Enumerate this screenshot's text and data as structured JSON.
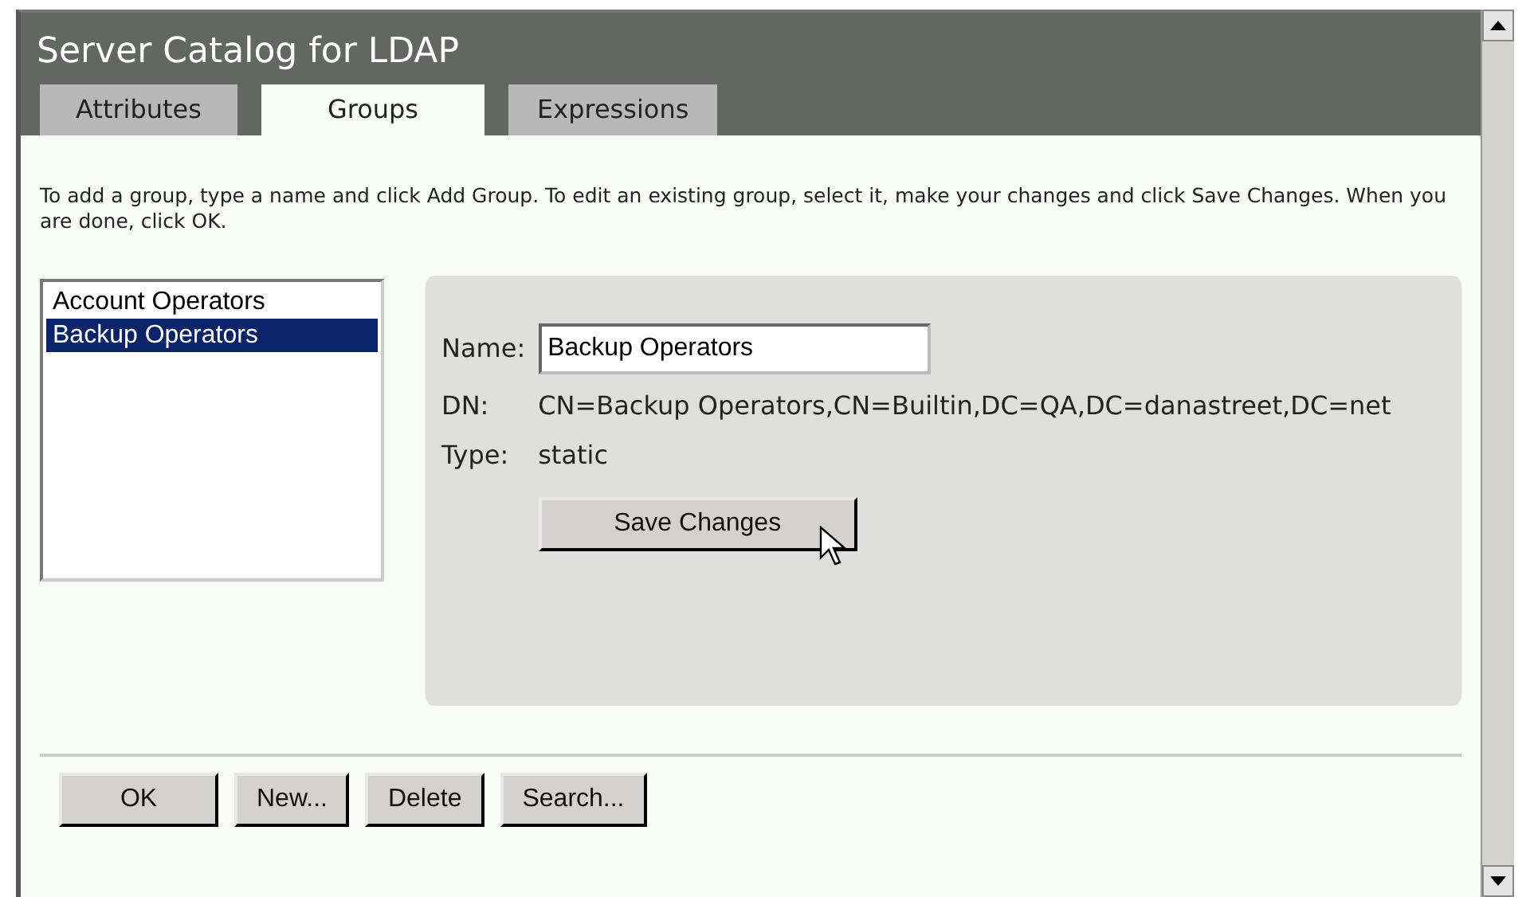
{
  "window": {
    "title": "Server Catalog for LDAP"
  },
  "tabs": [
    {
      "label": "Attributes",
      "selected": false
    },
    {
      "label": "Groups",
      "selected": true
    },
    {
      "label": "Expressions",
      "selected": false
    }
  ],
  "instructions": "To add a group, type a name and click Add Group. To edit an existing group, select it, make your changes and click Save Changes. When you are done, click OK.",
  "groups": [
    {
      "label": "Account Operators",
      "selected": false
    },
    {
      "label": "Backup Operators",
      "selected": true
    }
  ],
  "details": {
    "name_label": "Name:",
    "name_value": "Backup Operators",
    "dn_label": "DN:",
    "dn_value": "CN=Backup Operators,CN=Builtin,DC=QA,DC=danastreet,DC=net",
    "type_label": "Type:",
    "type_value": "static",
    "save_button": "Save Changes"
  },
  "buttons": [
    "OK",
    "New...",
    "Delete",
    "Search..."
  ]
}
